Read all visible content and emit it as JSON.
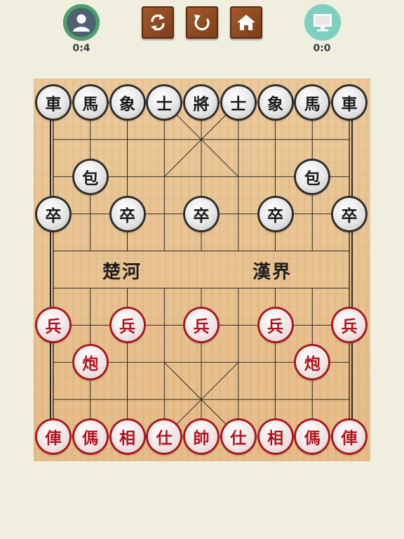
{
  "header": {
    "player_score": "0:4",
    "computer_score": "0:0",
    "buttons": [
      {
        "name": "swap-sides-button",
        "icon": "swap-arrows-icon"
      },
      {
        "name": "restart-button",
        "icon": "reload-icon"
      },
      {
        "name": "home-button",
        "icon": "house-icon"
      }
    ],
    "player_icon": "user-icon",
    "computer_icon": "monitor-icon"
  },
  "board": {
    "river_left": "楚河",
    "river_right": "漢界",
    "colors": {
      "black_piece_border": "#2e2e2e",
      "red_piece_border": "#a81820",
      "wood": "#e6bd89"
    },
    "black_pieces": [
      {
        "char": "車",
        "file": 0,
        "rank": 0
      },
      {
        "char": "馬",
        "file": 1,
        "rank": 0
      },
      {
        "char": "象",
        "file": 2,
        "rank": 0
      },
      {
        "char": "士",
        "file": 3,
        "rank": 0
      },
      {
        "char": "將",
        "file": 4,
        "rank": 0
      },
      {
        "char": "士",
        "file": 5,
        "rank": 0
      },
      {
        "char": "象",
        "file": 6,
        "rank": 0
      },
      {
        "char": "馬",
        "file": 7,
        "rank": 0
      },
      {
        "char": "車",
        "file": 8,
        "rank": 0
      },
      {
        "char": "包",
        "file": 1,
        "rank": 2
      },
      {
        "char": "包",
        "file": 7,
        "rank": 2
      },
      {
        "char": "卒",
        "file": 0,
        "rank": 3
      },
      {
        "char": "卒",
        "file": 2,
        "rank": 3
      },
      {
        "char": "卒",
        "file": 4,
        "rank": 3
      },
      {
        "char": "卒",
        "file": 6,
        "rank": 3
      },
      {
        "char": "卒",
        "file": 8,
        "rank": 3
      }
    ],
    "red_pieces": [
      {
        "char": "兵",
        "file": 0,
        "rank": 6
      },
      {
        "char": "兵",
        "file": 2,
        "rank": 6
      },
      {
        "char": "兵",
        "file": 4,
        "rank": 6
      },
      {
        "char": "兵",
        "file": 6,
        "rank": 6
      },
      {
        "char": "兵",
        "file": 8,
        "rank": 6
      },
      {
        "char": "炮",
        "file": 1,
        "rank": 7
      },
      {
        "char": "炮",
        "file": 7,
        "rank": 7
      },
      {
        "char": "俥",
        "file": 0,
        "rank": 9
      },
      {
        "char": "傌",
        "file": 1,
        "rank": 9
      },
      {
        "char": "相",
        "file": 2,
        "rank": 9
      },
      {
        "char": "仕",
        "file": 3,
        "rank": 9
      },
      {
        "char": "帥",
        "file": 4,
        "rank": 9
      },
      {
        "char": "仕",
        "file": 5,
        "rank": 9
      },
      {
        "char": "相",
        "file": 6,
        "rank": 9
      },
      {
        "char": "傌",
        "file": 7,
        "rank": 9
      },
      {
        "char": "俥",
        "file": 8,
        "rank": 9
      }
    ]
  }
}
